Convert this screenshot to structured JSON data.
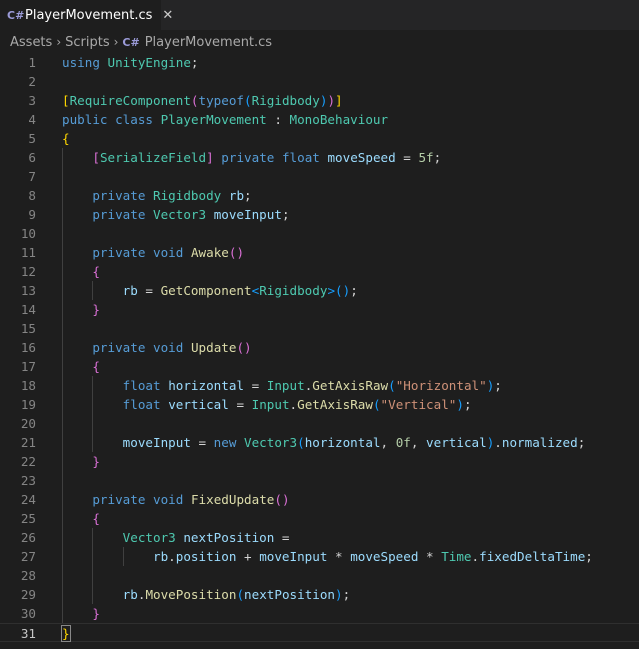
{
  "tab": {
    "title": "PlayerMovement.cs",
    "close_glyph": "✕"
  },
  "breadcrumb": {
    "items": [
      "Assets",
      "Scripts",
      "PlayerMovement.cs"
    ],
    "separator": "›"
  },
  "editor": {
    "current_line": 31,
    "line_numbers": [
      "1",
      "2",
      "3",
      "4",
      "5",
      "6",
      "7",
      "8",
      "9",
      "10",
      "11",
      "12",
      "13",
      "14",
      "15",
      "16",
      "17",
      "18",
      "19",
      "20",
      "21",
      "22",
      "23",
      "24",
      "25",
      "26",
      "27",
      "28",
      "29",
      "30",
      "31"
    ],
    "lines": [
      [
        [
          "kw",
          "using"
        ],
        [
          "pl",
          " "
        ],
        [
          "ty",
          "UnityEngine"
        ],
        [
          "pl",
          ";"
        ]
      ],
      [],
      [
        [
          "b1",
          "["
        ],
        [
          "ty",
          "RequireComponent"
        ],
        [
          "b2",
          "("
        ],
        [
          "kw",
          "typeof"
        ],
        [
          "b3",
          "("
        ],
        [
          "ty",
          "Rigidbody"
        ],
        [
          "b3",
          ")"
        ],
        [
          "b2",
          ")"
        ],
        [
          "b1",
          "]"
        ]
      ],
      [
        [
          "kw",
          "public"
        ],
        [
          "pl",
          " "
        ],
        [
          "kw",
          "class"
        ],
        [
          "pl",
          " "
        ],
        [
          "ty",
          "PlayerMovement"
        ],
        [
          "pl",
          " : "
        ],
        [
          "ty",
          "MonoBehaviour"
        ]
      ],
      [
        [
          "b1",
          "{"
        ]
      ],
      [
        [
          "pl",
          "    "
        ],
        [
          "b2",
          "["
        ],
        [
          "ty",
          "SerializeField"
        ],
        [
          "b2",
          "]"
        ],
        [
          "pl",
          " "
        ],
        [
          "kw",
          "private"
        ],
        [
          "pl",
          " "
        ],
        [
          "kw",
          "float"
        ],
        [
          "pl",
          " "
        ],
        [
          "va",
          "moveSpeed"
        ],
        [
          "pl",
          " = "
        ],
        [
          "nu",
          "5f"
        ],
        [
          "pl",
          ";"
        ]
      ],
      [],
      [
        [
          "pl",
          "    "
        ],
        [
          "kw",
          "private"
        ],
        [
          "pl",
          " "
        ],
        [
          "ty",
          "Rigidbody"
        ],
        [
          "pl",
          " "
        ],
        [
          "va",
          "rb"
        ],
        [
          "pl",
          ";"
        ]
      ],
      [
        [
          "pl",
          "    "
        ],
        [
          "kw",
          "private"
        ],
        [
          "pl",
          " "
        ],
        [
          "ty",
          "Vector3"
        ],
        [
          "pl",
          " "
        ],
        [
          "va",
          "moveInput"
        ],
        [
          "pl",
          ";"
        ]
      ],
      [],
      [
        [
          "pl",
          "    "
        ],
        [
          "kw",
          "private"
        ],
        [
          "pl",
          " "
        ],
        [
          "kw",
          "void"
        ],
        [
          "pl",
          " "
        ],
        [
          "fn",
          "Awake"
        ],
        [
          "b2",
          "()"
        ]
      ],
      [
        [
          "pl",
          "    "
        ],
        [
          "b2",
          "{"
        ]
      ],
      [
        [
          "pl",
          "        "
        ],
        [
          "va",
          "rb"
        ],
        [
          "pl",
          " = "
        ],
        [
          "fn",
          "GetComponent"
        ],
        [
          "b3",
          "<"
        ],
        [
          "ty",
          "Rigidbody"
        ],
        [
          "b3",
          ">"
        ],
        [
          "b3",
          "()"
        ],
        [
          "pl",
          ";"
        ]
      ],
      [
        [
          "pl",
          "    "
        ],
        [
          "b2",
          "}"
        ]
      ],
      [],
      [
        [
          "pl",
          "    "
        ],
        [
          "kw",
          "private"
        ],
        [
          "pl",
          " "
        ],
        [
          "kw",
          "void"
        ],
        [
          "pl",
          " "
        ],
        [
          "fn",
          "Update"
        ],
        [
          "b2",
          "()"
        ]
      ],
      [
        [
          "pl",
          "    "
        ],
        [
          "b2",
          "{"
        ]
      ],
      [
        [
          "pl",
          "        "
        ],
        [
          "kw",
          "float"
        ],
        [
          "pl",
          " "
        ],
        [
          "va",
          "horizontal"
        ],
        [
          "pl",
          " = "
        ],
        [
          "ty",
          "Input"
        ],
        [
          "pl",
          "."
        ],
        [
          "fn",
          "GetAxisRaw"
        ],
        [
          "b3",
          "("
        ],
        [
          "st",
          "\"Horizontal\""
        ],
        [
          "b3",
          ")"
        ],
        [
          "pl",
          ";"
        ]
      ],
      [
        [
          "pl",
          "        "
        ],
        [
          "kw",
          "float"
        ],
        [
          "pl",
          " "
        ],
        [
          "va",
          "vertical"
        ],
        [
          "pl",
          " = "
        ],
        [
          "ty",
          "Input"
        ],
        [
          "pl",
          "."
        ],
        [
          "fn",
          "GetAxisRaw"
        ],
        [
          "b3",
          "("
        ],
        [
          "st",
          "\"Vertical\""
        ],
        [
          "b3",
          ")"
        ],
        [
          "pl",
          ";"
        ]
      ],
      [],
      [
        [
          "pl",
          "        "
        ],
        [
          "va",
          "moveInput"
        ],
        [
          "pl",
          " = "
        ],
        [
          "kw",
          "new"
        ],
        [
          "pl",
          " "
        ],
        [
          "ty",
          "Vector3"
        ],
        [
          "b3",
          "("
        ],
        [
          "va",
          "horizontal"
        ],
        [
          "pl",
          ", "
        ],
        [
          "nu",
          "0f"
        ],
        [
          "pl",
          ", "
        ],
        [
          "va",
          "vertical"
        ],
        [
          "b3",
          ")"
        ],
        [
          "pl",
          "."
        ],
        [
          "va",
          "normalized"
        ],
        [
          "pl",
          ";"
        ]
      ],
      [
        [
          "pl",
          "    "
        ],
        [
          "b2",
          "}"
        ]
      ],
      [],
      [
        [
          "pl",
          "    "
        ],
        [
          "kw",
          "private"
        ],
        [
          "pl",
          " "
        ],
        [
          "kw",
          "void"
        ],
        [
          "pl",
          " "
        ],
        [
          "fn",
          "FixedUpdate"
        ],
        [
          "b2",
          "()"
        ]
      ],
      [
        [
          "pl",
          "    "
        ],
        [
          "b2",
          "{"
        ]
      ],
      [
        [
          "pl",
          "        "
        ],
        [
          "ty",
          "Vector3"
        ],
        [
          "pl",
          " "
        ],
        [
          "va",
          "nextPosition"
        ],
        [
          "pl",
          " ="
        ]
      ],
      [
        [
          "pl",
          "            "
        ],
        [
          "va",
          "rb"
        ],
        [
          "pl",
          "."
        ],
        [
          "va",
          "position"
        ],
        [
          "pl",
          " + "
        ],
        [
          "va",
          "moveInput"
        ],
        [
          "pl",
          " * "
        ],
        [
          "va",
          "moveSpeed"
        ],
        [
          "pl",
          " * "
        ],
        [
          "ty",
          "Time"
        ],
        [
          "pl",
          "."
        ],
        [
          "va",
          "fixedDeltaTime"
        ],
        [
          "pl",
          ";"
        ]
      ],
      [],
      [
        [
          "pl",
          "        "
        ],
        [
          "va",
          "rb"
        ],
        [
          "pl",
          "."
        ],
        [
          "fn",
          "MovePosition"
        ],
        [
          "b3",
          "("
        ],
        [
          "va",
          "nextPosition"
        ],
        [
          "b3",
          ")"
        ],
        [
          "pl",
          ";"
        ]
      ],
      [
        [
          "pl",
          "    "
        ],
        [
          "b2",
          "}"
        ]
      ],
      [
        [
          "b1",
          "}"
        ]
      ]
    ]
  },
  "colors": {
    "background": "#1e1e1e",
    "tabbar_background": "#252526",
    "keyword": "#569cd6",
    "type": "#4ec9b0",
    "function": "#dcdcaa",
    "variable": "#9cdcfe",
    "number": "#b5cea8",
    "string": "#ce9178",
    "bracket_level1": "#ffd700",
    "bracket_level2": "#da70d6",
    "bracket_level3": "#179fff",
    "line_number": "#858585"
  },
  "icons": {
    "file_type": "csharp-file-icon",
    "close": "close-icon",
    "breadcrumb_separator": "chevron-right-icon"
  }
}
